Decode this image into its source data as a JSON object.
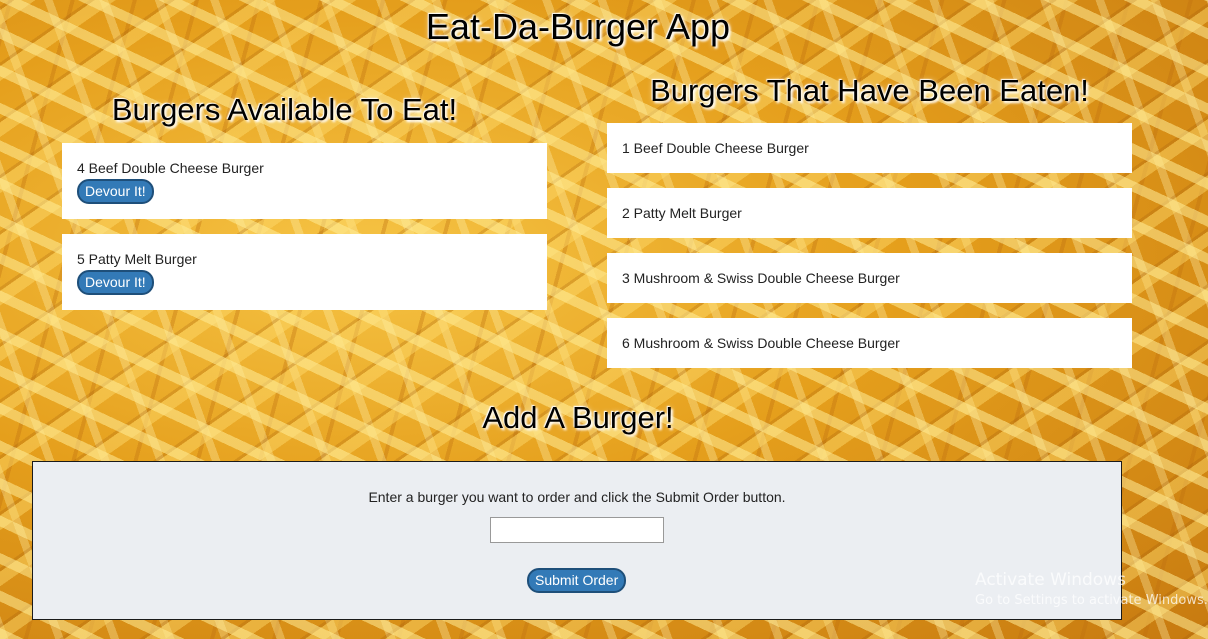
{
  "app": {
    "title": "Eat-Da-Burger App"
  },
  "available": {
    "heading": "Burgers Available To Eat!",
    "items": [
      {
        "label": "4 Beef Double Cheese Burger",
        "button": "Devour It!"
      },
      {
        "label": "5 Patty Melt Burger",
        "button": "Devour It!"
      }
    ]
  },
  "eaten": {
    "heading": "Burgers That Have Been Eaten!",
    "items": [
      {
        "label": "1 Beef Double Cheese Burger"
      },
      {
        "label": "2 Patty Melt Burger"
      },
      {
        "label": "3 Mushroom & Swiss Double Cheese Burger"
      },
      {
        "label": "6 Mushroom & Swiss Double Cheese Burger"
      }
    ]
  },
  "add": {
    "heading": "Add A Burger!",
    "instructions": "Enter a burger you want to order and click the Submit Order button.",
    "input_value": "",
    "submit_label": "Submit Order"
  },
  "watermark": {
    "title": "Activate Windows",
    "subtitle": "Go to Settings to activate Windows."
  },
  "colors": {
    "button_blue": "#337ab7",
    "panel_bg": "#ebeef2"
  }
}
